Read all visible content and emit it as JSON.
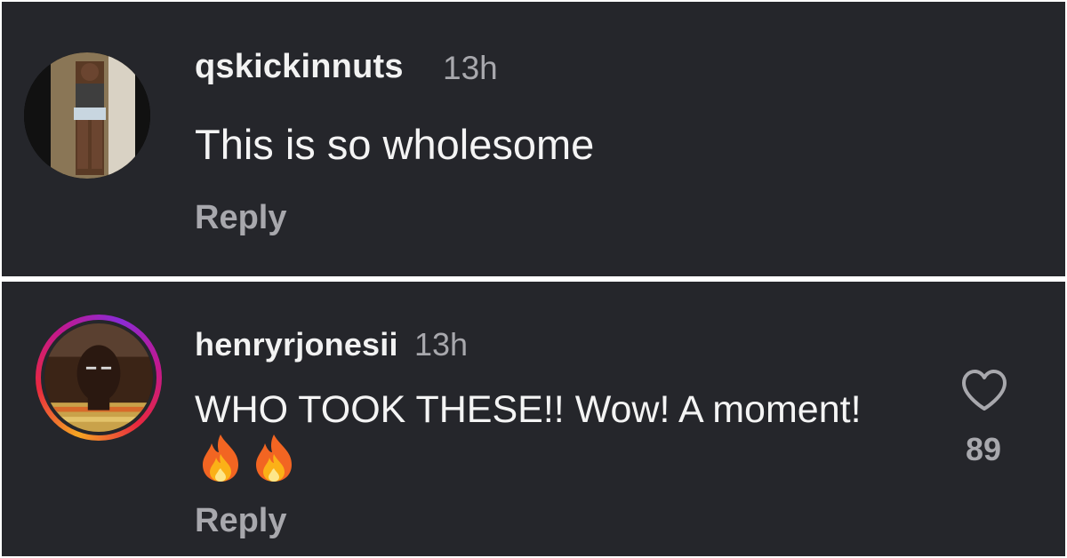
{
  "comments": [
    {
      "username": "qskickinnuts",
      "time": "13h",
      "text": "This is so wholesome",
      "reply_label": "Reply"
    },
    {
      "username": "henryrjonesii",
      "time": "13h",
      "text": "WHO TOOK THESE!! Wow! A moment!",
      "emojis": [
        "fire-emoji",
        "fire-emoji"
      ],
      "reply_label": "Reply",
      "like_count": "89",
      "story_ring": true
    }
  ],
  "icons": {
    "like": "heart-outline-icon"
  },
  "colors": {
    "background": "#25262b",
    "primary_text": "#f2f2f2",
    "secondary_text": "#a8a8ad"
  }
}
